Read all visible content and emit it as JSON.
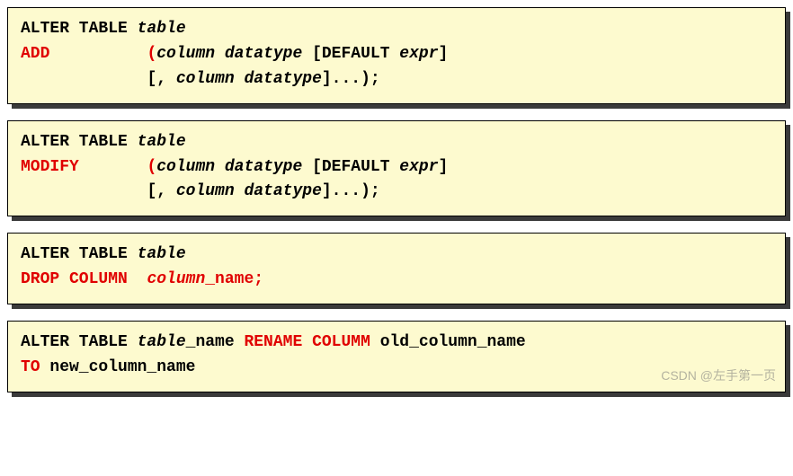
{
  "box1": {
    "l1_kw": "ALTER TABLE ",
    "l1_arg": "table",
    "l2_kw": "ADD",
    "l2_pad": "          ",
    "l2_paren": "(",
    "l2_arg": "column datatype ",
    "l2_def1": "[DEFAULT ",
    "l2_expr": "expr",
    "l2_def2": "]",
    "l3_pad": "             ",
    "l3_arg1": "[, ",
    "l3_arg2": "column datatype",
    "l3_arg3": "]...);"
  },
  "box2": {
    "l1_kw": "ALTER TABLE ",
    "l1_arg": "table",
    "l2_kw": "MODIFY",
    "l2_pad": "       ",
    "l2_paren": "(",
    "l2_arg": "column datatype ",
    "l2_def1": "[DEFAULT ",
    "l2_expr": "expr",
    "l2_def2": "]",
    "l3_pad": "             ",
    "l3_arg1": "[, ",
    "l3_arg2": "column datatype",
    "l3_arg3": "]...);"
  },
  "box3": {
    "l1_kw": "ALTER TABLE ",
    "l1_arg": "table",
    "l2_kw": "DROP COLUMN",
    "l2_pad": "  ",
    "l2_col": "column",
    "l2_name": "_name;"
  },
  "box4": {
    "l1_kw": "ALTER TABLE ",
    "l1_arg": "table",
    "l1_name": "_name ",
    "l1_rename": "RENAME COLUMM ",
    "l1_old": "old_column_name",
    "l2_to": "TO ",
    "l2_new": "new_column_name"
  },
  "watermark": "CSDN @左手第一页"
}
